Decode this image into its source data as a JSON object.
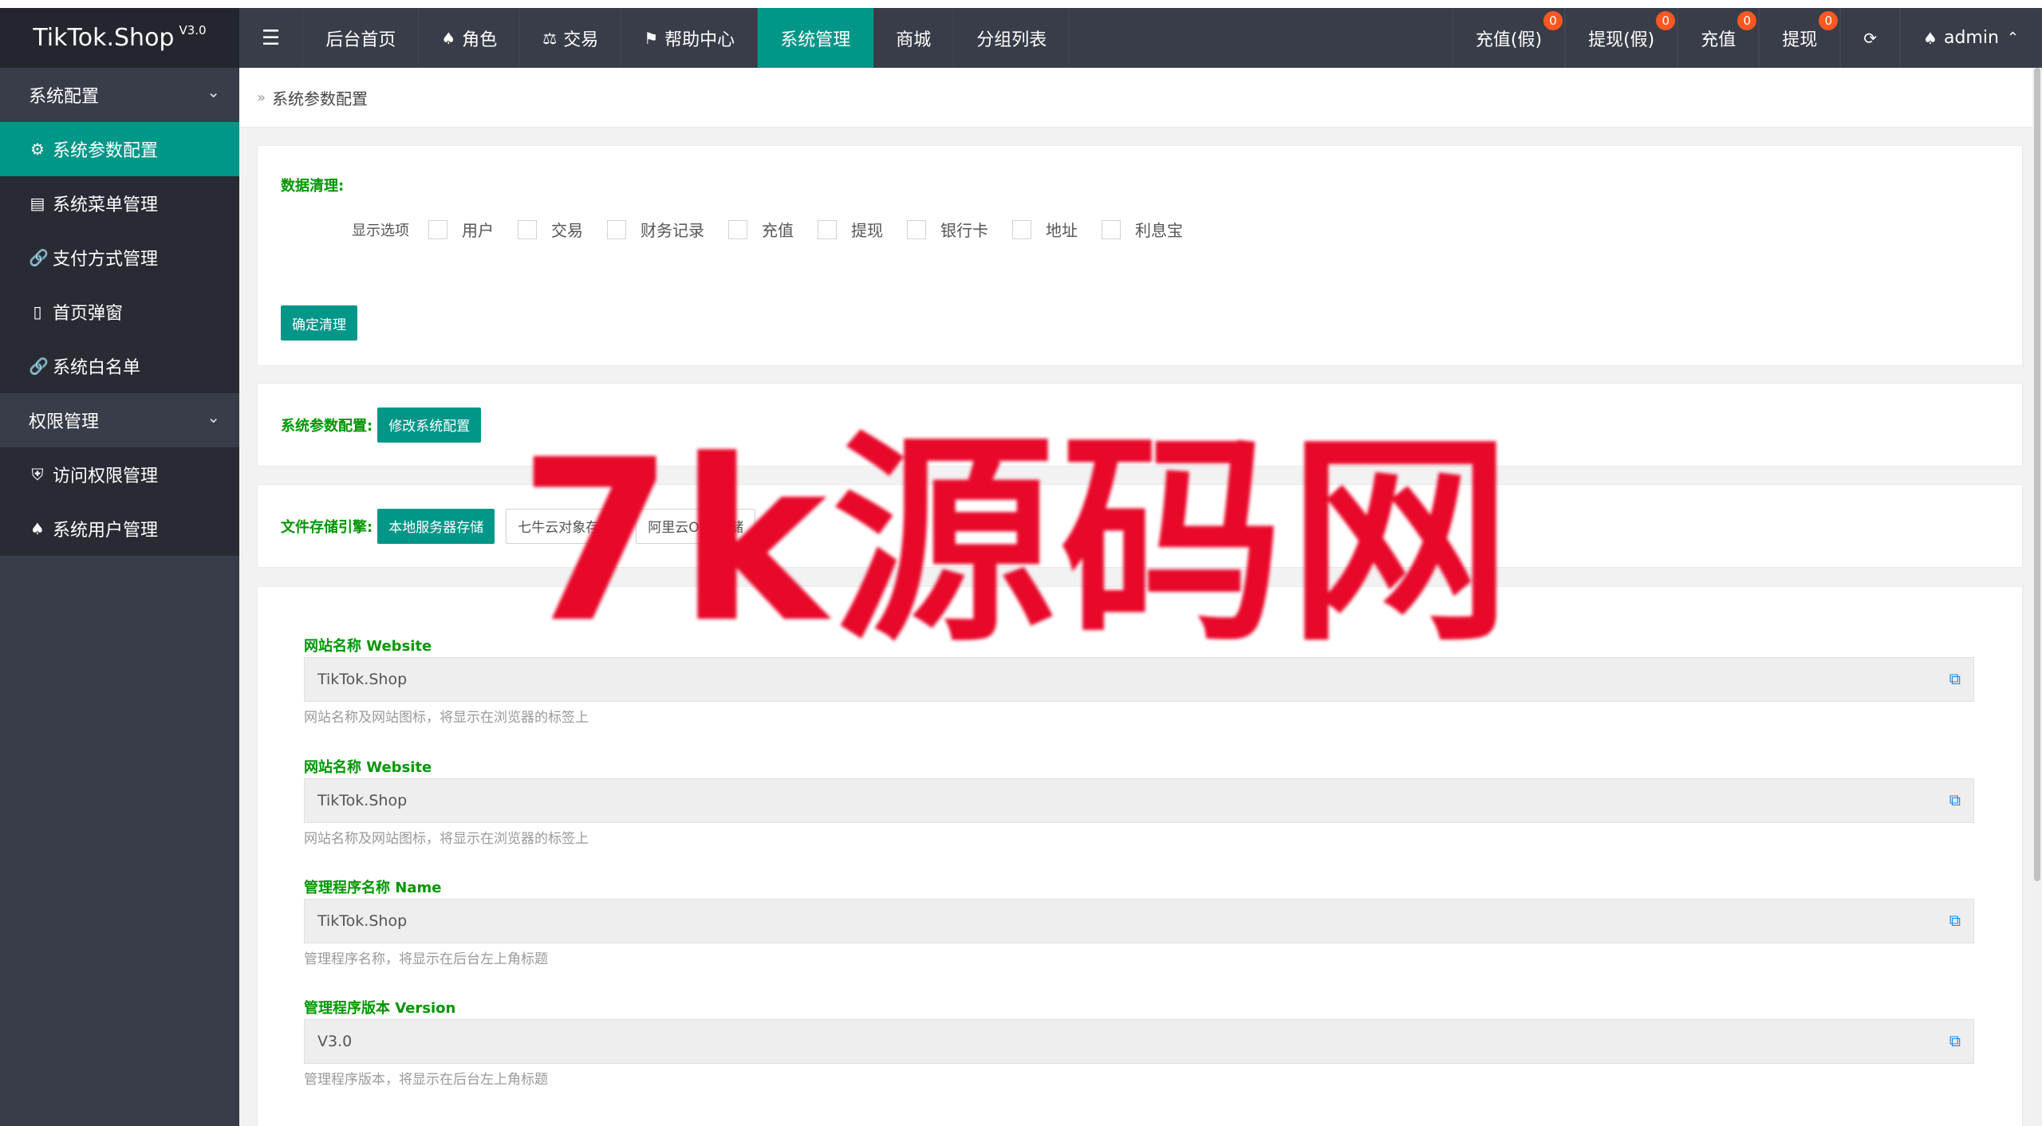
{
  "app": {
    "title": "TikTok.Shop",
    "version": "V3.0"
  },
  "header": {
    "menu_toggle": "☰",
    "nav": [
      {
        "label": "后台首页",
        "icon": ""
      },
      {
        "label": "角色",
        "icon": "user-icon"
      },
      {
        "label": "交易",
        "icon": "scale-icon"
      },
      {
        "label": "帮助中心",
        "icon": "flag-icon"
      },
      {
        "label": "系统管理",
        "icon": "",
        "active": true
      },
      {
        "label": "商城",
        "icon": ""
      },
      {
        "label": "分组列表",
        "icon": ""
      }
    ],
    "right": [
      {
        "label": "充值(假)",
        "badge": "0"
      },
      {
        "label": "提现(假)",
        "badge": "0"
      },
      {
        "label": "充值",
        "badge": "0"
      },
      {
        "label": "提现",
        "badge": "0"
      }
    ],
    "refresh_icon": "refresh-icon",
    "user": "admin"
  },
  "sidebar": {
    "groups": [
      {
        "label": "系统配置",
        "items": [
          {
            "label": "系统参数配置",
            "icon": "gear-icon",
            "active": true
          },
          {
            "label": "系统菜单管理",
            "icon": "calendar-icon"
          },
          {
            "label": "支付方式管理",
            "icon": "link-icon"
          },
          {
            "label": "首页弹窗",
            "icon": "phone-icon"
          },
          {
            "label": "系统白名单",
            "icon": "link-icon"
          }
        ]
      },
      {
        "label": "权限管理",
        "items": [
          {
            "label": "访问权限管理",
            "icon": "shield-icon"
          },
          {
            "label": "系统用户管理",
            "icon": "user-icon"
          }
        ]
      }
    ]
  },
  "breadcrumb": {
    "current": "系统参数配置"
  },
  "data_clean": {
    "title": "数据清理:",
    "display_label": "显示选项",
    "options": [
      "用户",
      "交易",
      "财务记录",
      "充值",
      "提现",
      "银行卡",
      "地址",
      "利息宝"
    ],
    "confirm_button": "确定清理"
  },
  "sys_config": {
    "title": "系统参数配置:",
    "button": "修改系统配置"
  },
  "storage": {
    "title": "文件存储引擎:",
    "buttons": [
      "本地服务器存储",
      "七牛云对象存储",
      "阿里云OSS存储"
    ]
  },
  "fields": [
    {
      "label": "网站名称 Website",
      "value": "TikTok.Shop",
      "help": "网站名称及网站图标，将显示在浏览器的标签上"
    },
    {
      "label": "网站名称 Website",
      "value": "TikTok.Shop",
      "help": "网站名称及网站图标，将显示在浏览器的标签上"
    },
    {
      "label": "管理程序名称 Name",
      "value": "TikTok.Shop",
      "help": "管理程序名称，将显示在后台左上角标题"
    },
    {
      "label": "管理程序版本 Version",
      "value": "V3.0",
      "help": "管理程序版本，将显示在后台左上角标题"
    }
  ],
  "watermark": "7k源码网"
}
